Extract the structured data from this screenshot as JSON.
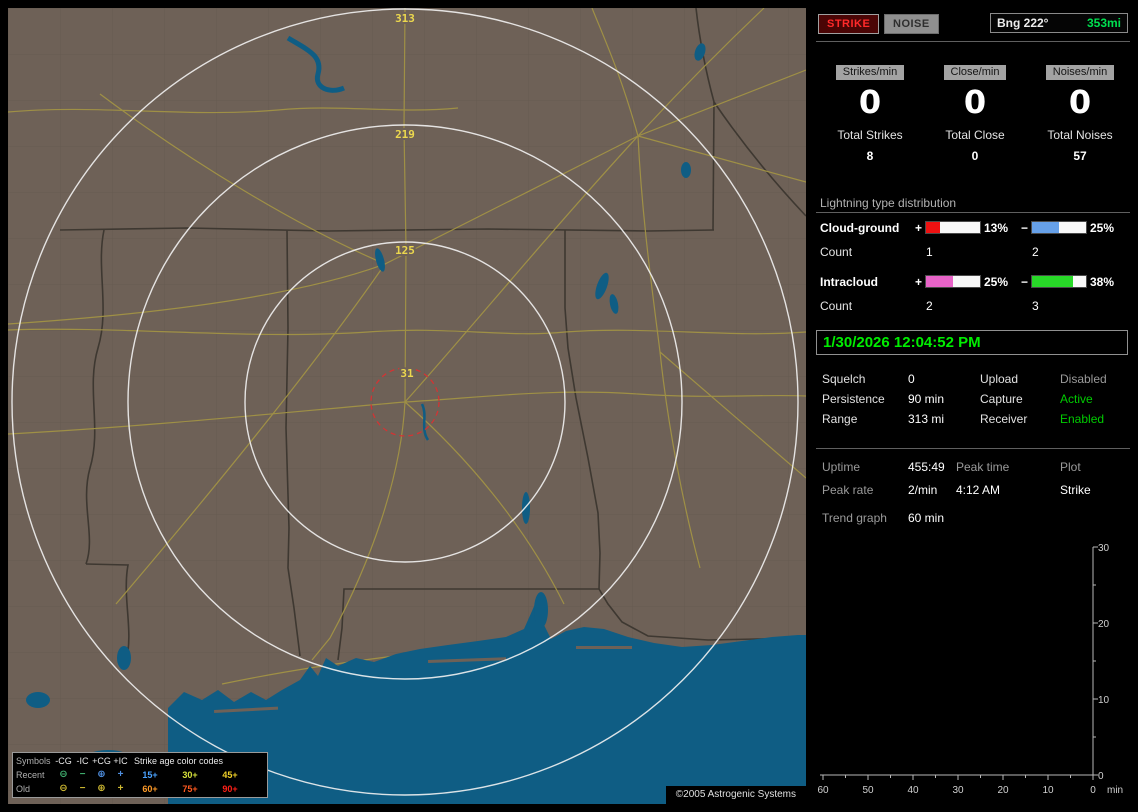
{
  "map": {
    "range_labels": [
      "313",
      "219",
      "125",
      "31"
    ],
    "copyright": "©2005 Astrogenic Systems",
    "colors": {
      "land": "#6e6157",
      "water": "#0f5d84",
      "road": "#a29345",
      "state_border": "#3e3831",
      "range_ring": "#f2f2f2",
      "alarm_ring": "#d23434",
      "range_label": "#ecd84e"
    }
  },
  "legend": {
    "header_symbols": "Symbols",
    "symbol_columns": [
      "-CG",
      "-IC",
      "+CG",
      "+IC"
    ],
    "header_age": "Strike age color codes",
    "symbols": [
      "⊖",
      "−",
      "⊕",
      "+"
    ],
    "rows": [
      {
        "label": "Recent",
        "symbol_colors": [
          "#3fae6e",
          "#3fae6e",
          "#4f8fe0",
          "#4f8fe0"
        ],
        "ages": [
          {
            "text": "15+",
            "color": "#4aa2ff"
          },
          {
            "text": "30+",
            "color": "#d8e23c"
          },
          {
            "text": "45+",
            "color": "#f0d028"
          }
        ]
      },
      {
        "label": "Old",
        "symbol_colors": [
          "#cdb832",
          "#cdb832",
          "#cdb832",
          "#cdb832"
        ],
        "ages": [
          {
            "text": "60+",
            "color": "#ff9b28"
          },
          {
            "text": "75+",
            "color": "#ff5a20"
          },
          {
            "text": "90+",
            "color": "#ff2018"
          }
        ]
      }
    ]
  },
  "panel": {
    "top": {
      "strike": "STRIKE",
      "noise": "NOISE",
      "bng_label": "Bng 222°",
      "bng_value": "353mi",
      "bng_value_color": "#00e050"
    },
    "counters": [
      {
        "rate_label": "Strikes/min",
        "rate": "0",
        "total_label": "Total Strikes",
        "total": "8"
      },
      {
        "rate_label": "Close/min",
        "rate": "0",
        "total_label": "Total Close",
        "total": "0"
      },
      {
        "rate_label": "Noises/min",
        "rate": "0",
        "total_label": "Total Noises",
        "total": "57"
      }
    ],
    "distribution": {
      "title": "Lightning type distribution",
      "count_label": "Count",
      "plus_sign": "+",
      "minus_sign": "−",
      "rows": [
        {
          "name": "Cloud-ground",
          "plus": {
            "pct": "13%",
            "fill": "26%",
            "color": "#ee1111",
            "count": "1"
          },
          "minus": {
            "pct": "25%",
            "fill": "50%",
            "color": "#66a0e8",
            "count": "2"
          }
        },
        {
          "name": "Intracloud",
          "plus": {
            "pct": "25%",
            "fill": "50%",
            "color": "#e863c8",
            "count": "2"
          },
          "minus": {
            "pct": "38%",
            "fill": "76%",
            "color": "#28d828",
            "count": "3"
          }
        }
      ]
    },
    "timestamp": {
      "text": "1/30/2026 12:04:52 PM",
      "color": "#00ee00"
    },
    "settings": {
      "rows": [
        {
          "l1": "Squelch",
          "v1": "0",
          "l2": "Upload",
          "v2": "Disabled",
          "v2_color": "#9a9a9a"
        },
        {
          "l1": "Persistence",
          "v1": "90 min",
          "l2": "Capture",
          "v2": "Active",
          "v2_color": "#00cc00"
        },
        {
          "l1": "Range",
          "v1": "313 mi",
          "l2": "Receiver",
          "v2": "Enabled",
          "v2_color": "#00cc00"
        }
      ]
    },
    "stats": {
      "uptime_label": "Uptime",
      "uptime": "455:49",
      "peaktime_label": "Peak time",
      "plot_label": "Plot",
      "peakrate_label": "Peak rate",
      "peakrate": "2/min",
      "peaktime": "4:12 AM",
      "plot": "Strike",
      "trend_label": "Trend graph",
      "trend_value": "60 min"
    },
    "trend": {
      "y_ticks": [
        "30",
        "20",
        "10",
        "0"
      ],
      "x_ticks": [
        "60",
        "50",
        "40",
        "30",
        "20",
        "10",
        "0"
      ],
      "x_unit": "min"
    }
  }
}
